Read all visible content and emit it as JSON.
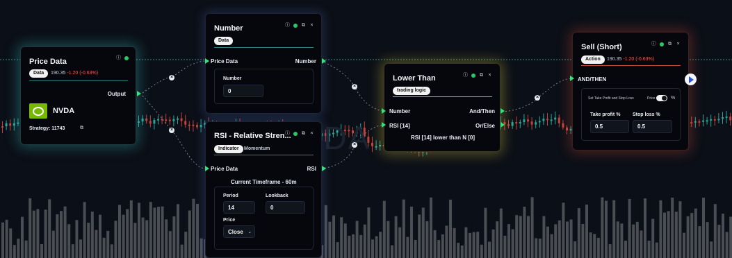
{
  "colors": {
    "bull": "#26a69a",
    "bear": "#c3423a",
    "port": "#2ee67a",
    "volume": "#4a4d53"
  },
  "watermark": "VIDA",
  "price_data": {
    "title": "Price Data",
    "badge": "Data",
    "price": "190.35",
    "change": "-1.20 (-0.63%)",
    "output": "Output",
    "ticker": "NVDA",
    "logo": "nvidia-logo",
    "strategy_label": "Strategy: 11743"
  },
  "number_node": {
    "title": "Number",
    "badge": "Data",
    "in_port": "Price Data",
    "out_port": "Number",
    "field_label": "Number",
    "field_value": "0"
  },
  "rsi_node": {
    "title": "RSI - Relative Stren...",
    "tab1": "Indicator",
    "tab2": "Momentum",
    "in_port": "Price Data",
    "out_port": "RSI",
    "timeframe": "Current Timeframe - 60m",
    "period_label": "Period",
    "period_value": "14",
    "lookback_label": "Lookback",
    "lookback_value": "0",
    "price_label": "Price",
    "price_value": "Close"
  },
  "lower_than": {
    "title": "Lower Than",
    "badge": "trading logic",
    "in1": "Number",
    "in2": "RSI [14]",
    "out1": "And/Then",
    "out2": "Or/Else",
    "expression": "RSI [14] lower than N [0]"
  },
  "sell_node": {
    "title": "Sell (Short)",
    "badge": "Action",
    "price": "190.35",
    "change": "-1.20 (-0.63%)",
    "in_port": "AND/THEN",
    "tpsl_label": "Set Take Profit and Stop Loss",
    "price_toggle_label": "Price",
    "pct_label": "%",
    "tp_label": "Take profit %",
    "tp_value": "0.5",
    "sl_label": "Stop loss %",
    "sl_value": "0.5"
  }
}
